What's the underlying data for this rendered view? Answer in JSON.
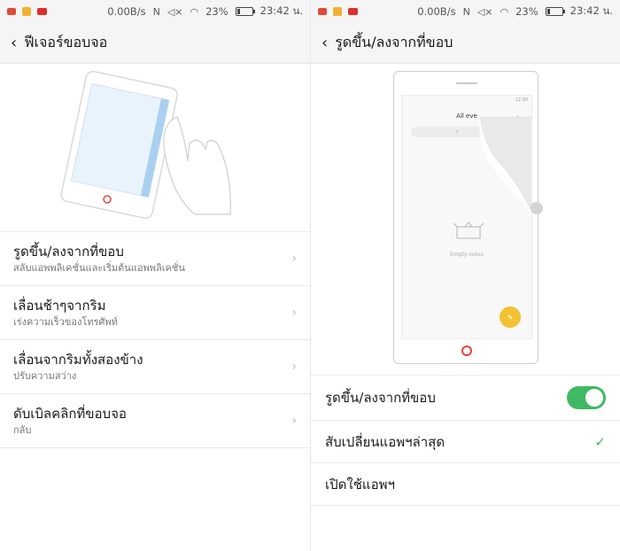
{
  "status_bar": {
    "network_speed": "0.00B/s",
    "battery": "23%",
    "battery_level": 0.23,
    "time": "23:42 น.",
    "app_icons": [
      "gmail-icon",
      "game-icon",
      "youtube-icon"
    ]
  },
  "left": {
    "header": {
      "title": "ฟีเจอร์ขอบจอ"
    },
    "items": [
      {
        "title": "รูดขึ้น/ลงจากที่ขอบ",
        "subtitle": "สลับแอพพลิเคชั่นและเริ่มต้นแอพพลิเคชั่น"
      },
      {
        "title": "เลื่อนช้าๆจากริม",
        "subtitle": "เร่งความเร็วของโทรศัพท์"
      },
      {
        "title": "เลื่อนจากริมทั้งสองข้าง",
        "subtitle": "ปรับความสว่าง"
      },
      {
        "title": "ดับเบิลคลิกที่ขอบจอ",
        "subtitle": "กลับ"
      }
    ]
  },
  "right": {
    "header": {
      "title": "รูดขึ้น/ลงจากที่ขอบ"
    },
    "preview": {
      "mini_time": "12:30",
      "mini_title": "All eve",
      "empty_label": "Empty notes"
    },
    "toggle": {
      "label": "รูดขึ้น/ลงจากที่ขอบ",
      "on": true
    },
    "options": [
      {
        "label": "สับเปลี่ยนแอพฯล่าสุด",
        "checked": true
      },
      {
        "label": "เปิดใช้แอพฯ",
        "checked": false
      }
    ]
  },
  "colors": {
    "accent": "#3fb963",
    "home_button": "#e8443a",
    "fab": "#f2c232"
  }
}
